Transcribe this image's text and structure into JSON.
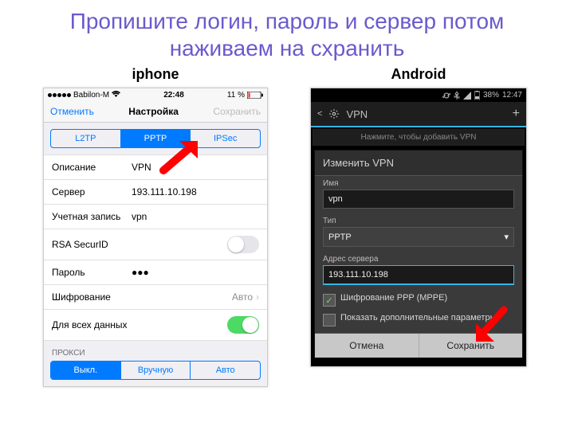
{
  "title": "Пропишите логин, пароль и сервер потом наживаем на схранить",
  "iphone": {
    "label": "iphone",
    "status": {
      "carrier": "Babilon-M",
      "time": "22:48",
      "battery": "11 %"
    },
    "nav": {
      "cancel": "Отменить",
      "title": "Настройка",
      "save": "Сохранить"
    },
    "seg": [
      "L2TP",
      "PPTP",
      "IPSec"
    ],
    "rows": {
      "desc": {
        "lab": "Описание",
        "val": "VPN"
      },
      "server": {
        "lab": "Сервер",
        "val": "193.111.10.198"
      },
      "account": {
        "lab": "Учетная запись",
        "val": "vpn"
      },
      "rsa": {
        "lab": "RSA SecurID"
      },
      "pass": {
        "lab": "Пароль",
        "val": "●●●"
      },
      "enc": {
        "lab": "Шифрование",
        "val": "Авто"
      },
      "all": {
        "lab": "Для всех данных"
      }
    },
    "proxy": {
      "section": "ПРОКСИ",
      "seg": [
        "Выкл.",
        "Вручную",
        "Авто"
      ]
    }
  },
  "android": {
    "label": "Android",
    "status": {
      "battery": "38%",
      "time": "12:47"
    },
    "bar": {
      "title": "VPN"
    },
    "hint": "Нажмите, чтобы добавить VPN",
    "dialog": {
      "title": "Изменить VPN",
      "name_lab": "Имя",
      "name_val": "vpn",
      "type_lab": "Тип",
      "type_val": "PPTP",
      "srv_lab": "Адрес сервера",
      "srv_val": "193.111.10.198",
      "mppe": "Шифрование PPP (MPPE)",
      "adv": "Показать дополнительные параметры",
      "cancel": "Отмена",
      "save": "Сохранить"
    }
  }
}
